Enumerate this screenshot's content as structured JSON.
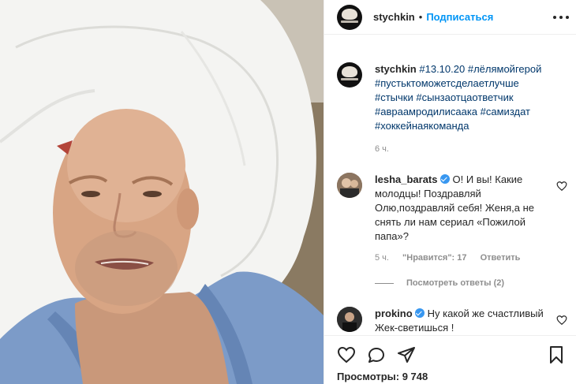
{
  "post": {
    "username": "stychkin",
    "separator": "•",
    "follow_label": "Подписаться",
    "caption_tags": [
      "#13.10.20",
      "#лёлямойгерой",
      "#пустьктоможетсделаетлучше",
      "#стычки",
      "#сынзаотцаответчик",
      "#авраамродилисаака",
      "#самиздат",
      "#хоккейнаякоманда"
    ],
    "time": "6 ч."
  },
  "comments": [
    {
      "username": "lesha_barats",
      "verified": true,
      "text": "О! И вы! Какие молодцы! Поздравляй Олю,поздравляй себя! Женя,а не снять ли нам сериал «Пожилой папа»?",
      "time": "5 ч.",
      "likes": "\"Нравится\": 17",
      "reply": "Ответить",
      "view_replies": "Посмотреть ответы (2)"
    },
    {
      "username": "prokino",
      "verified": true,
      "text": "Ну какой же счастливый Жек-светишься !"
    }
  ],
  "footer": {
    "views_label": "Просмотры:",
    "views_count": "9 748"
  },
  "colors": {
    "link": "#0095f6",
    "hashtag": "#00376b",
    "secondary": "#8e8e8e"
  }
}
